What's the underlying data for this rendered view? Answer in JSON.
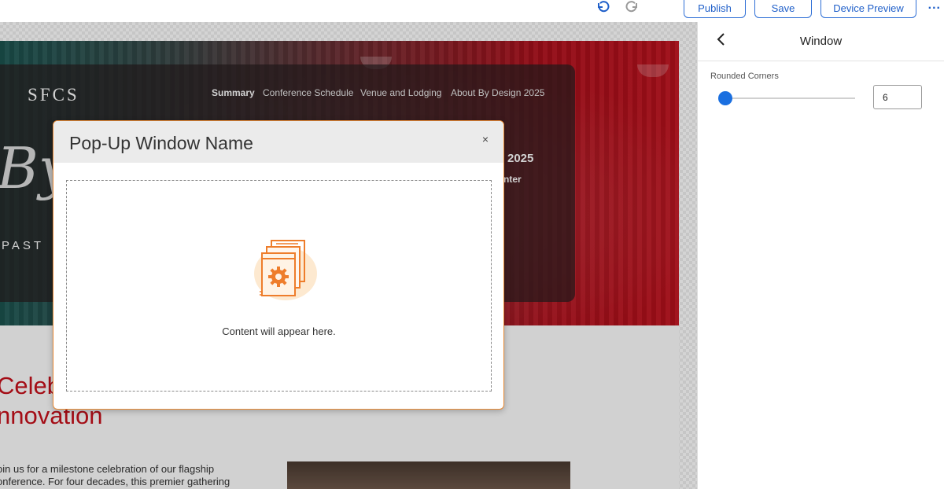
{
  "toolbar": {
    "publish_label": "Publish",
    "save_label": "Save",
    "device_preview_label": "Device Preview",
    "more_label": "..."
  },
  "site": {
    "logo": "SFCS",
    "nav": [
      "Summary",
      "Conference Schedule",
      "Venue and Lodging",
      "About By Design 2025"
    ],
    "script_text": "By",
    "past_text": "PAST",
    "year_text": "2025",
    "center_text": "nter",
    "celebrate_line1": "Celeb",
    "celebrate_line2": "nnovation",
    "intro_line1": "oin us for a milestone celebration of our flagship",
    "intro_line2": "onference. For four decades, this premier gathering"
  },
  "modal": {
    "title": "Pop-Up Window Name",
    "close_label": "×",
    "placeholder_text": "Content will appear here."
  },
  "panel": {
    "title": "Window",
    "rounded_corners_label": "Rounded Corners",
    "rounded_corners_value": "6"
  },
  "colors": {
    "accent": "#1a6fe0",
    "modal_border": "#e88a35",
    "brand_red": "#c8101b"
  }
}
